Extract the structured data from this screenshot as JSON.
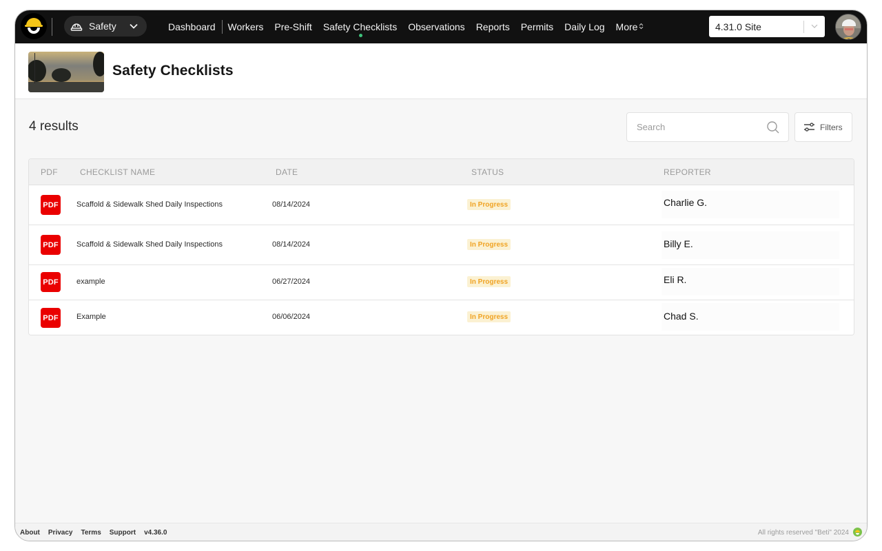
{
  "topbar": {
    "module": {
      "label": "Safety",
      "icon": "hard-hat-icon"
    },
    "nav": [
      {
        "label": "Dashboard",
        "active": false
      },
      {
        "label": "Workers",
        "active": false
      },
      {
        "label": "Pre-Shift",
        "active": false
      },
      {
        "label": "Safety Checklists",
        "active": true
      },
      {
        "label": "Observations",
        "active": false
      },
      {
        "label": "Reports",
        "active": false
      },
      {
        "label": "Permits",
        "active": false
      },
      {
        "label": "Daily Log",
        "active": false
      },
      {
        "label": "More",
        "active": false,
        "icon": "up-down-chevron-icon"
      }
    ],
    "more_icon": "⇕",
    "site_select": {
      "value": "4.31.0 Site"
    },
    "active_indicator_color": "#3ec27c"
  },
  "page": {
    "title": "Safety Checklists",
    "results_label": "4 results"
  },
  "search": {
    "placeholder": "Search",
    "value": ""
  },
  "filters": {
    "label": "Filters"
  },
  "table": {
    "columns": [
      "PDF",
      "CHECKLIST NAME",
      "DATE",
      "STATUS",
      "REPORTER"
    ],
    "rows": [
      {
        "pdf": "PDF",
        "name": "Scaffold & Sidewalk Shed Daily Inspections",
        "date": "08/14/2024",
        "status": "In Progress",
        "reporter": "Charlie G."
      },
      {
        "pdf": "PDF",
        "name": "Scaffold & Sidewalk Shed Daily Inspections",
        "date": "08/14/2024",
        "status": "In Progress",
        "reporter": "Billy E."
      },
      {
        "pdf": "PDF",
        "name": "example",
        "date": "06/27/2024",
        "status": "In Progress",
        "reporter": "Eli R."
      },
      {
        "pdf": "PDF",
        "name": "Example",
        "date": "06/06/2024",
        "status": "In Progress",
        "reporter": "Chad S."
      }
    ]
  },
  "footer": {
    "links": [
      "About",
      "Privacy",
      "Terms",
      "Support"
    ],
    "version": "v4.36.0",
    "copyright": "All rights reserved \"Beti\" 2024"
  },
  "colors": {
    "topbar": "#111111",
    "pdf_red": "#ea0000",
    "status_bg": "#fbf1d2",
    "status_text": "#f0a324",
    "brand_yellow": "#f5c518"
  }
}
